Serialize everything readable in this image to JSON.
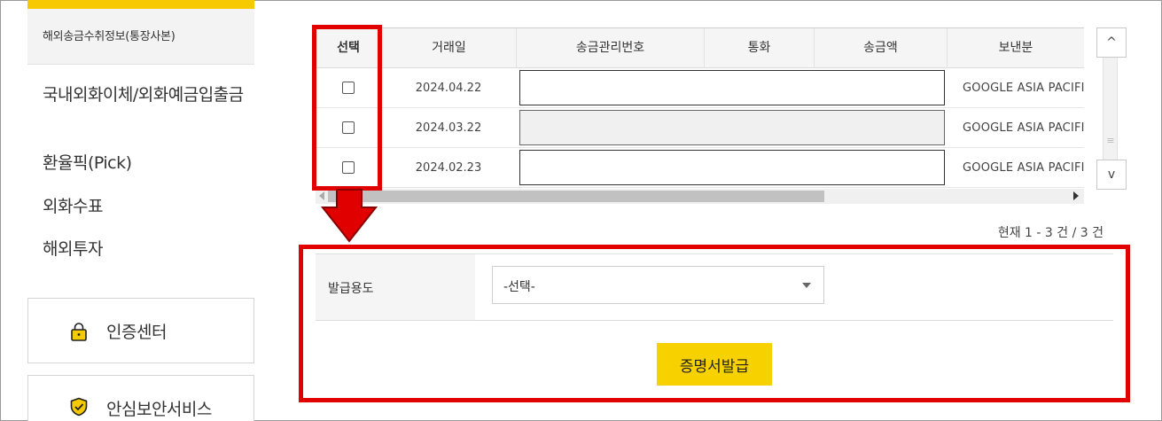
{
  "sidebar": {
    "active_item": "해외송금수취정보(통장사본)",
    "items": [
      {
        "label": "국내외화이체/외화예금입출금"
      },
      {
        "label": "환율픽(Pick)"
      },
      {
        "label": "외화수표"
      },
      {
        "label": "해외투자"
      }
    ],
    "cards": [
      {
        "label": "인증센터",
        "icon": "lock-icon"
      },
      {
        "label": "안심보안서비스",
        "icon": "shield-check-icon"
      }
    ]
  },
  "table": {
    "headers": [
      "선택",
      "거래일",
      "송금관리번호",
      "통화",
      "송금액",
      "보낸분"
    ],
    "rows": [
      {
        "date": "2024.04.22",
        "sender": "GOOGLE ASIA PACIFIC",
        "checked": false
      },
      {
        "date": "2024.03.22",
        "sender": "GOOGLE ASIA PACIFIC",
        "checked": false
      },
      {
        "date": "2024.02.23",
        "sender": "GOOGLE ASIA PACIFIC",
        "checked": false
      }
    ],
    "count_text": "현재 1 - 3 건 / 3 건"
  },
  "scroll": {
    "up_label": "^",
    "down_label": "v",
    "grip_label": "≡"
  },
  "form": {
    "purpose_label": "발급용도",
    "purpose_selected": "-선택-",
    "issue_button": "증명서발급"
  },
  "colors": {
    "accent_yellow": "#f7c900",
    "annotation_red": "#e00000"
  }
}
